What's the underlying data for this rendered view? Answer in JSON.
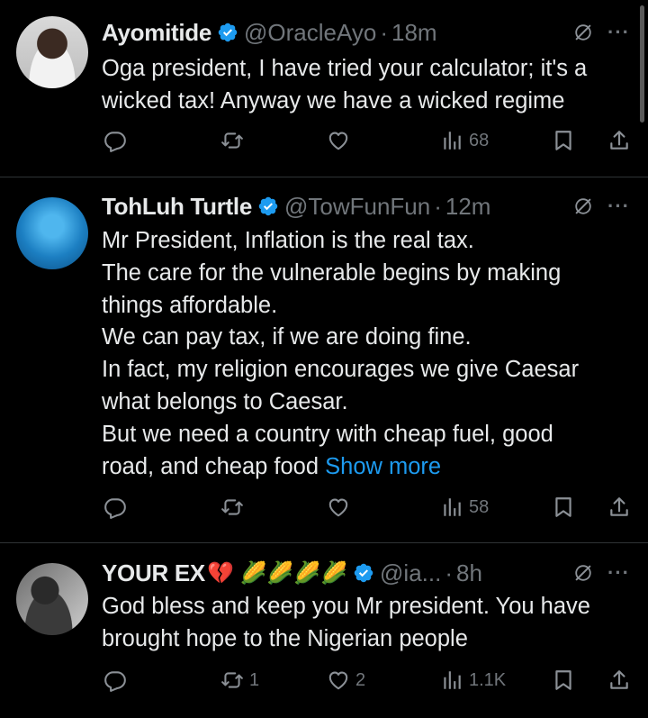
{
  "tweets": [
    {
      "name": "Ayomitide",
      "handle": "@OracleAyo",
      "time": "18m",
      "lines": [
        "Oga president, I have tried your calculator; it's a",
        "wicked tax! Anyway we have a wicked regime"
      ],
      "replies": "",
      "retweets": "",
      "likes": "",
      "views": "68"
    },
    {
      "name": "TohLuh Turtle",
      "handle": "@TowFunFun",
      "time": "12m",
      "lines": [
        "Mr President, Inflation is the real tax.",
        "The care for the vulnerable begins by making",
        "things affordable.",
        "We can pay tax, if we are doing fine.",
        "In fact, my religion encourages we give Caesar",
        "what belongs to Caesar.",
        "But we need a country with cheap fuel, good"
      ],
      "last_line": "road, and cheap food",
      "show_more": "Show more",
      "replies": "",
      "retweets": "",
      "likes": "",
      "views": "58"
    },
    {
      "name": "YOUR EX",
      "emojis": "💔 🌽🌽🌽🌽",
      "handle": "@ia...",
      "time": "8h",
      "lines": [
        "God bless and keep you Mr president. You have",
        "brought hope to the Nigerian people"
      ],
      "replies": "",
      "retweets": "1",
      "likes": "2",
      "views": "1.1K"
    }
  ],
  "separator": "·",
  "more_glyph": "···",
  "colors": {
    "background": "#000000",
    "text": "#e7e9ea",
    "muted": "#71767b",
    "link": "#1d9bf0",
    "verified": "#1d9bf0",
    "divider": "#2f3336"
  },
  "icons": [
    "verified-badge-icon",
    "grok-icon",
    "more-icon",
    "reply-icon",
    "retweet-icon",
    "like-icon",
    "views-icon",
    "bookmark-icon",
    "share-icon"
  ]
}
